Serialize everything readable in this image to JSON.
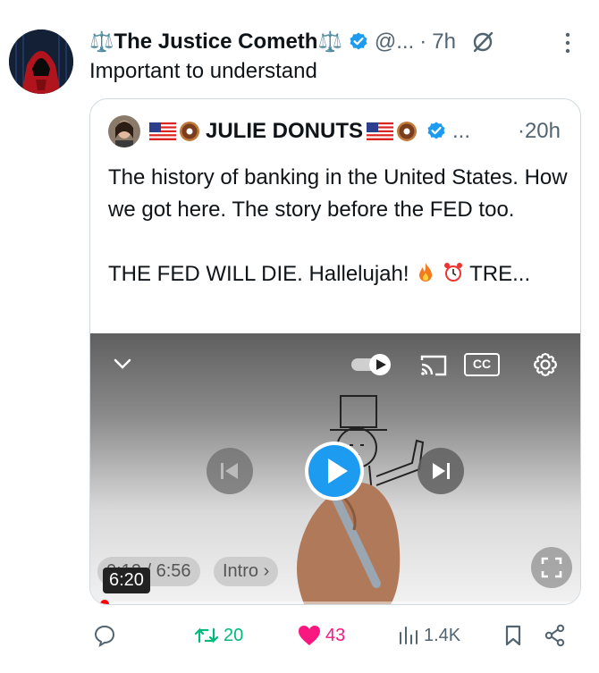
{
  "tweet": {
    "author_prefix": "⚖️",
    "author_name": "The Justice Cometh",
    "author_suffix": "⚖️",
    "handle": "@...",
    "separator": "·",
    "time": "7h",
    "text": "Important to understand"
  },
  "quote": {
    "author_name": "JULIE DONUTS",
    "ellipsis": "...",
    "time": "·20h",
    "paragraph1": "The history of banking in the United States. How we got here. The story before the FED too.",
    "paragraph2_text": "THE FED WILL DIE. Hallelujah!",
    "paragraph2_tail": "TRE..."
  },
  "video": {
    "current_time": "0:12",
    "total_time": "6:56",
    "chapter_label": "Intro ›",
    "duration_badge": "6:20",
    "cc_label": "CC",
    "progress": 0.02
  },
  "actions": {
    "retweets": "20",
    "likes": "43",
    "views": "1.4K"
  },
  "colors": {
    "verified": "#1d9bf0",
    "retweet": "#00ba7c",
    "like": "#f91880",
    "muted": "#536471"
  }
}
